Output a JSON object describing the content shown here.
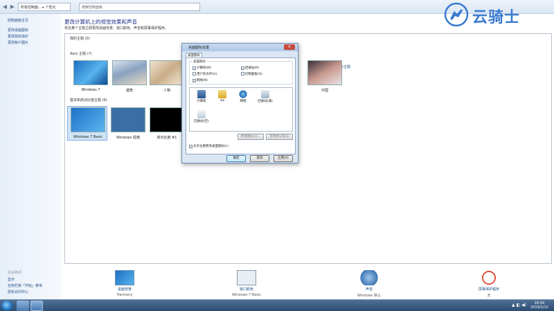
{
  "addressbar": {
    "crumb1": "所有控制面...",
    "crumb2": "个性化",
    "search_placeholder": "搜索控制面板"
  },
  "leftnav": {
    "home": "控制面板主页",
    "items": [
      "更改桌面图标",
      "更改鼠标指针",
      "更改帐户图片"
    ],
    "see_also_header": "另请参阅",
    "see_also": [
      "显示",
      "任务栏和「开始」菜单",
      "轻松访问中心"
    ]
  },
  "main": {
    "title": "更改计算机上的视觉效果和声音",
    "description": "单击某个主题立即更改桌面背景、窗口颜色、声音和屏幕保护程序。",
    "my_themes": "我的主题 (0)",
    "online_link": "联机获取更多主题",
    "aero_section": "Aero 主题 (7)",
    "aero_themes": [
      "Windows 7",
      "建筑",
      "人物",
      "中国"
    ],
    "basic_section": "基本和高对比度主题 (6)",
    "basic_themes": [
      "Windows 7 Basic",
      "Windows 经典",
      "高对比度 #1"
    ]
  },
  "bottom": {
    "background_label": "桌面背景",
    "background_value": "Harmony",
    "color_label": "窗口颜色",
    "color_value": "Windows 7 Basic",
    "sound_label": "声音",
    "sound_value": "Windows 默认",
    "saver_label": "屏幕保护程序",
    "saver_value": "无"
  },
  "dialog": {
    "title": "桌面图标设置",
    "close_glyph": "×",
    "tab": "桌面图标",
    "group_title": "桌面图标",
    "checkboxes": [
      {
        "label": "计算机(M)",
        "checked": true
      },
      {
        "label": "回收站(R)",
        "checked": true
      },
      {
        "label": "用户的文件(U)",
        "checked": false
      },
      {
        "label": "控制面板(O)",
        "checked": false
      },
      {
        "label": "网络(N)",
        "checked": true
      }
    ],
    "icons": [
      "计算机",
      "wz",
      "网络",
      "回收站(满)",
      "回收站(空)"
    ],
    "change_icon": "更改图标(H)...",
    "restore_default": "还原默认值(S)",
    "allow_themes": "允许主题更改桌面图标(L)",
    "ok": "确定",
    "cancel": "取消",
    "apply": "应用(A)"
  },
  "taskbar": {
    "tray": "▲ ◧ ◀)",
    "time": "16:54",
    "date": "2019/1/12"
  },
  "watermark": "云骑士"
}
